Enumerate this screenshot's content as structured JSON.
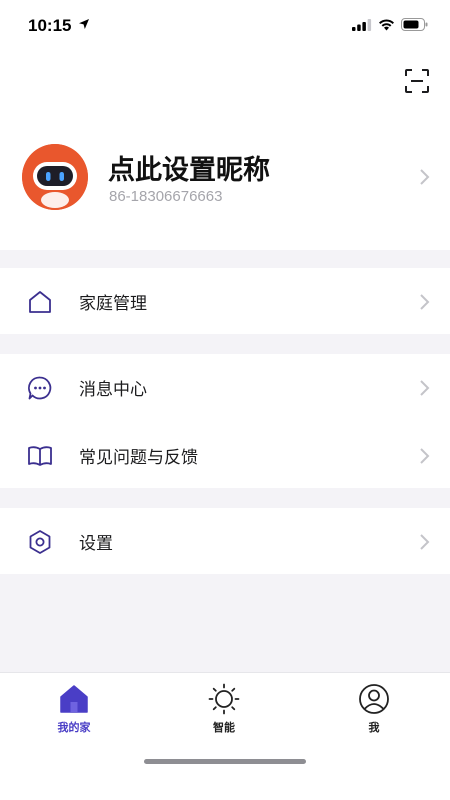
{
  "status_bar": {
    "time": "10:15",
    "location_icon": "location-arrow-icon",
    "signal_icon": "cellular-signal-icon",
    "wifi_icon": "wifi-icon",
    "battery_icon": "battery-icon"
  },
  "header": {
    "scan_icon": "scan-icon"
  },
  "profile": {
    "nickname": "点此设置昵称",
    "phone": "86-18306676663",
    "avatar_icon": "robot-avatar-icon"
  },
  "menu": {
    "family": {
      "label": "家庭管理",
      "icon": "home-outline-icon"
    },
    "messages": {
      "label": "消息中心",
      "icon": "chat-bubble-icon"
    },
    "faq": {
      "label": "常见问题与反馈",
      "icon": "open-book-icon"
    },
    "settings": {
      "label": "设置",
      "icon": "hexagon-settings-icon"
    }
  },
  "tabs": [
    {
      "label": "我的家",
      "icon": "home-filled-icon",
      "active": true
    },
    {
      "label": "智能",
      "icon": "sun-icon",
      "active": false
    },
    {
      "label": "我",
      "icon": "user-circle-icon",
      "active": false
    }
  ],
  "colors": {
    "accent": "#4a3ec6",
    "background": "#f4f3f7",
    "card": "#ffffff",
    "text_secondary": "#a5a5ab",
    "avatar": "#e9572d"
  }
}
